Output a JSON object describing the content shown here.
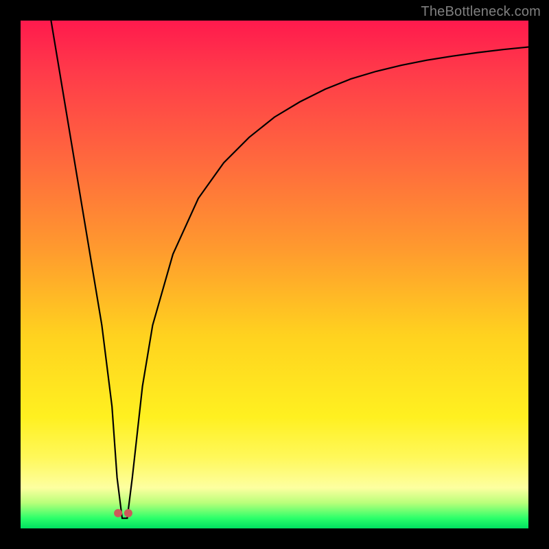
{
  "watermark": "TheBottleneck.com",
  "chart_data": {
    "type": "line",
    "title": "",
    "xlabel": "",
    "ylabel": "",
    "xlim": [
      0,
      100
    ],
    "ylim": [
      0,
      100
    ],
    "grid": false,
    "legend": false,
    "background_gradient": {
      "orientation": "vertical",
      "stops": [
        {
          "pos": 0.0,
          "color": "#ff1a4d",
          "meaning": "high"
        },
        {
          "pos": 0.5,
          "color": "#ffb028",
          "meaning": "mid"
        },
        {
          "pos": 0.82,
          "color": "#fff030",
          "meaning": "low-mid"
        },
        {
          "pos": 1.0,
          "color": "#00e060",
          "meaning": "low"
        }
      ]
    },
    "series": [
      {
        "name": "bottleneck-curve",
        "color": "#000000",
        "x": [
          6,
          8,
          10,
          12,
          14,
          16,
          18,
          19,
          20,
          21,
          22,
          24,
          26,
          30,
          35,
          40,
          45,
          50,
          55,
          60,
          65,
          70,
          75,
          80,
          85,
          90,
          95,
          100
        ],
        "y": [
          100,
          88,
          76,
          64,
          52,
          40,
          24,
          10,
          2,
          2,
          10,
          28,
          40,
          54,
          65,
          72,
          77,
          81,
          84,
          86.5,
          88.5,
          90,
          91.2,
          92.2,
          93,
          93.7,
          94.3,
          94.8
        ]
      }
    ],
    "markers": [
      {
        "name": "min-left",
        "x": 19.2,
        "y": 3,
        "color": "#cc5a5a",
        "r": 6
      },
      {
        "name": "min-right",
        "x": 21.2,
        "y": 3,
        "color": "#cc5a5a",
        "r": 6
      }
    ],
    "note": "y values express height of the black curve from the bottom (0) to top (100), estimated visually; the curve minimum touches the green band near x≈20."
  }
}
